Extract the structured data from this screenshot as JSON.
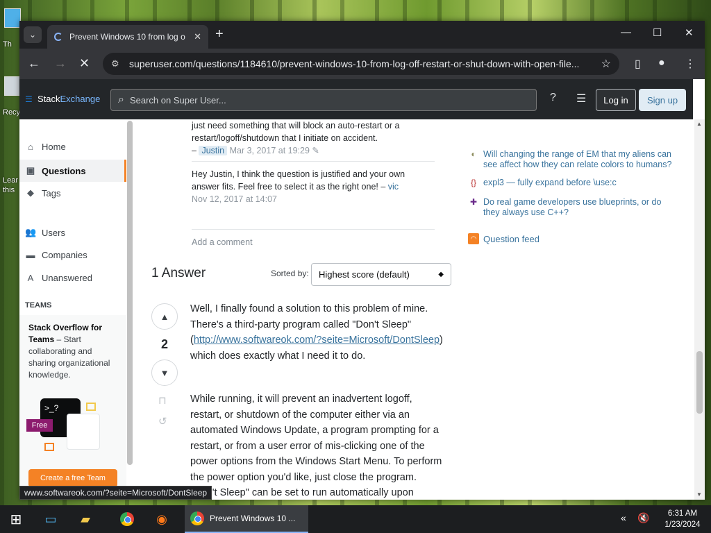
{
  "desktop": {
    "icon_labels": [
      "Th",
      "Recy",
      "Lear",
      "this"
    ]
  },
  "browser": {
    "tab": {
      "title": "Prevent Windows 10 from log o",
      "close": "✕"
    },
    "new_tab": "+",
    "window_controls": {
      "minimize": "—",
      "maximize": "☐",
      "close": "✕"
    },
    "url": "superuser.com/questions/1184610/prevent-windows-10-from-log-off-restart-or-shut-down-with-open-file..."
  },
  "site_header": {
    "logo_part1": "Stack",
    "logo_part2": "Exchange",
    "search_placeholder": "Search on Super User...",
    "login": "Log in",
    "signup": "Sign up"
  },
  "left_nav": {
    "items": [
      {
        "label": "Home",
        "icon": "home-icon"
      },
      {
        "label": "Questions",
        "icon": "questions-icon",
        "active": true
      },
      {
        "label": "Tags",
        "icon": "tag-icon"
      },
      {
        "label": "Users",
        "icon": "users-icon"
      },
      {
        "label": "Companies",
        "icon": "companies-icon"
      },
      {
        "label": "Unanswered",
        "icon": "unanswered-icon"
      }
    ],
    "teams_label": "TEAMS",
    "teams_title": "Stack Overflow for Teams",
    "teams_desc": " – Start collaborating and sharing organizational knowledge.",
    "teams_badge": "Free",
    "teams_terminal": ">_?",
    "teams_cta": "Create a free Team"
  },
  "comments": [
    {
      "text": "just need something that will block an auto-restart or a restart/logoff/shutdown that I initiate on accident.",
      "dash": " – ",
      "user": "Justin",
      "date": "Mar 3, 2017 at 19:29",
      "edit_icon": "✎"
    },
    {
      "text": "Hey Justin, I think the question is justified and your own answer fits. Feel free to select it as the right one! – ",
      "user": "vic",
      "date": "Nov 12, 2017 at 14:07"
    }
  ],
  "add_comment": "Add a comment",
  "answers": {
    "heading": "1 Answer",
    "sorted_by": "Sorted by:",
    "sort_value": "Highest score (default)",
    "score": "2",
    "para1_pre": "Well, I finally found a solution to this problem of mine. There's a third-party program called \"Don't Sleep\" (",
    "para1_link": "http://www.softwareok.com/?seite=Microsoft/DontSleep",
    "para1_post": ") which does exactly what I need it to do.",
    "para2": "While running, it will prevent an inadvertent logoff, restart, or shutdown of the computer either via an automated Windows Update, a program prompting for a restart, or from a user error of mis-clicking one of the power options from the Windows Start Menu. To perform the power option you'd like, just close the program. \"Don't Sleep\" can be set to run automatically upon startup and can keep itself in the"
  },
  "sidebar": {
    "hot_questions": [
      {
        "text": "Will changing the range of EM that my aliens can see affect how they can relate colors to humans?",
        "icon": "worldbuilding-icon"
      },
      {
        "text": "expl3 — fully expand before \\use:c",
        "icon": "tex-icon"
      },
      {
        "text": "Do real game developers use blueprints, or do they always use C++?",
        "icon": "gamedev-icon"
      }
    ],
    "question_feed": "Question feed"
  },
  "status_url": "www.softwareok.com/?seite=Microsoft/DontSleep",
  "taskbar": {
    "active_app_title": "Prevent Windows 10 ...",
    "time": "6:31 AM",
    "date": "1/23/2024"
  }
}
